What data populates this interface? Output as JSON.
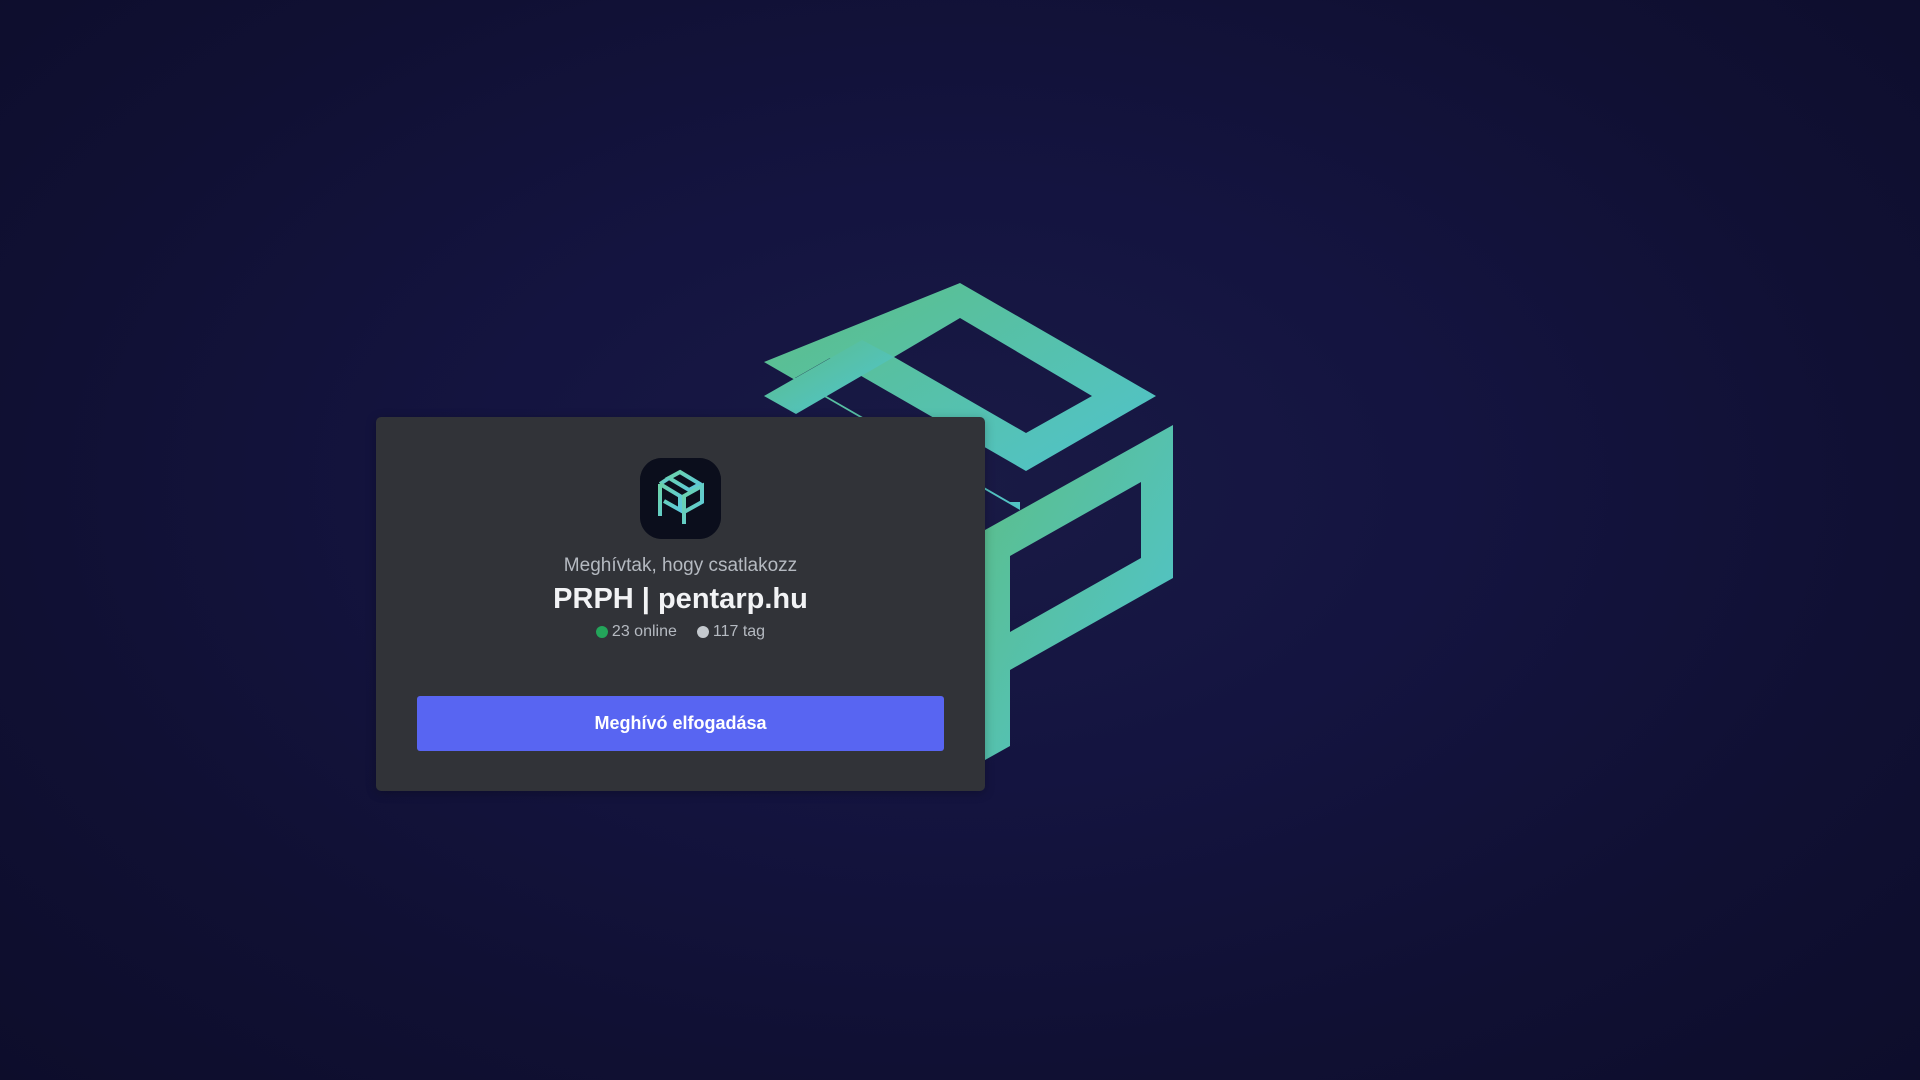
{
  "invite": {
    "intro_text": "Meghívtak, hogy csatlakozz",
    "server_name": "PRPH | pentarp.hu",
    "online_count_text": "23 online",
    "member_count_text": "117 tag",
    "accept_button_label": "Meghívó elfogadása"
  },
  "icons": {
    "server_icon": "server-logo-cube-icon",
    "background_logo": "pentarp-cube-logo",
    "online_indicator": "online-status-dot",
    "member_indicator": "member-status-dot"
  },
  "colors": {
    "background": "#141440",
    "card": "#313338",
    "button": "#5865f2",
    "online_dot": "#23a55a",
    "member_dot": "#c4c9ce",
    "logo_green": "#5bbd8c",
    "logo_cyan": "#4ec3cf"
  }
}
